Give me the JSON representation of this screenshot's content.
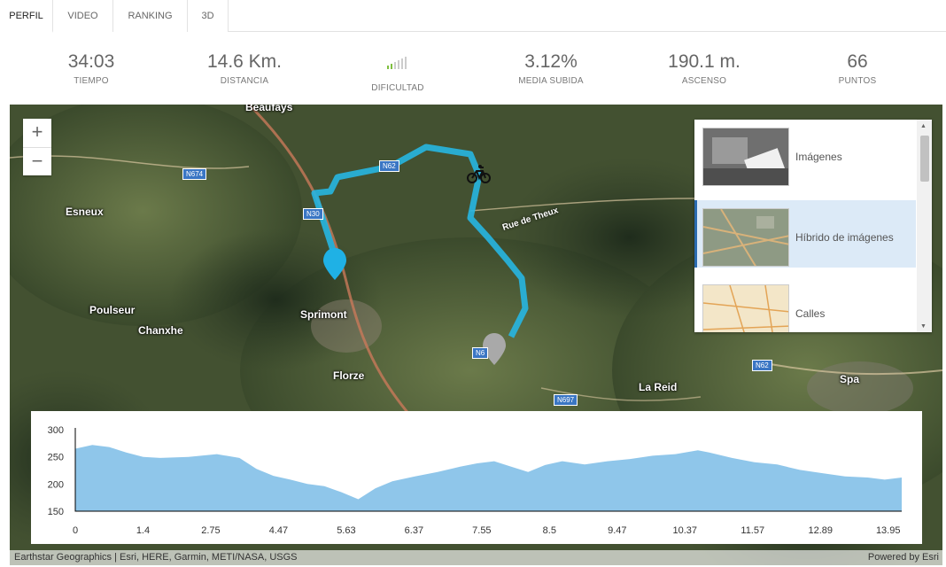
{
  "tabs": [
    {
      "label": "PERFIL",
      "active": true
    },
    {
      "label": "VIDEO",
      "active": false
    },
    {
      "label": "RANKING",
      "active": false
    },
    {
      "label": "3D",
      "active": false
    }
  ],
  "stats": {
    "time": {
      "value": "34:03",
      "label": "TIEMPO"
    },
    "distance": {
      "value": "14.6 Km.",
      "label": "DISTANCIA"
    },
    "difficulty": {
      "label": "DIFICULTAD",
      "icon": "signal-bars-icon"
    },
    "slope": {
      "value": "3.12%",
      "label": "MEDIA SUBIDA"
    },
    "ascent": {
      "value": "190.1 m.",
      "label": "ASCENSO"
    },
    "points": {
      "value": "66",
      "label": "PUNTOS"
    }
  },
  "map": {
    "zoom_in": "+",
    "zoom_out": "−",
    "places": {
      "beaufays": "Beaufays",
      "esneux": "Esneux",
      "poulseur": "Poulseur",
      "chanxhe": "Chanxhe",
      "sprimont": "Sprimont",
      "florze": "Florze",
      "la_reid": "La Reid",
      "spa": "Spa"
    },
    "road_label": "Rue de Theux",
    "shields": {
      "n674": "N674",
      "n62a": "N62",
      "n30": "N30",
      "n62b": "N62",
      "n697": "N697",
      "n6x": "N6"
    },
    "attribution": "Earthstar Geographics | Esri, HERE, Garmin, METI/NASA, USGS",
    "powered_by": "Powered by Esri"
  },
  "gallery": {
    "items": [
      {
        "label": "Imágenes",
        "selected": false
      },
      {
        "label": "Híbrido de imágenes",
        "selected": true
      },
      {
        "label": "Calles",
        "selected": false
      }
    ]
  },
  "chart_data": {
    "type": "area",
    "xlabel": "",
    "ylabel": "",
    "ylim": [
      150,
      300
    ],
    "yticks": [
      "300",
      "250",
      "200",
      "150"
    ],
    "xticks": [
      "0",
      "1.4",
      "2.75",
      "4.47",
      "5.63",
      "6.37",
      "7.55",
      "8.5",
      "9.47",
      "10.37",
      "11.57",
      "12.89",
      "13.95"
    ],
    "x": [
      0,
      0.3,
      0.6,
      0.9,
      1.2,
      1.5,
      2.0,
      2.5,
      2.9,
      3.2,
      3.5,
      3.8,
      4.1,
      4.4,
      4.7,
      5.0,
      5.3,
      5.6,
      6.0,
      6.4,
      6.8,
      7.1,
      7.4,
      7.7,
      8.0,
      8.3,
      8.6,
      9.0,
      9.4,
      9.8,
      10.2,
      10.6,
      11.0,
      11.2,
      11.6,
      12.0,
      12.4,
      12.8,
      13.2,
      13.6,
      14.0,
      14.3,
      14.6
    ],
    "y": [
      265,
      272,
      268,
      258,
      250,
      248,
      250,
      255,
      248,
      228,
      215,
      208,
      200,
      196,
      185,
      172,
      192,
      205,
      214,
      222,
      232,
      238,
      242,
      232,
      222,
      235,
      242,
      236,
      242,
      246,
      252,
      255,
      262,
      258,
      248,
      240,
      236,
      226,
      220,
      214,
      212,
      208,
      212
    ]
  }
}
